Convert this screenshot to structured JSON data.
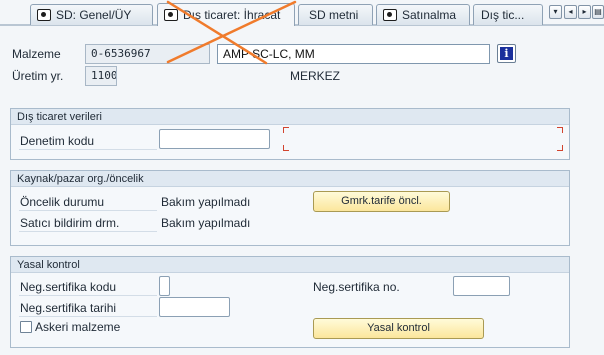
{
  "tabs": [
    {
      "label": "SD: Genel/ÜY",
      "has_icon": true,
      "active": false
    },
    {
      "label": "Dış ticaret: İhracat",
      "has_icon": true,
      "active": true
    },
    {
      "label": "SD metni",
      "has_icon": false,
      "active": false
    },
    {
      "label": "Satınalma",
      "has_icon": true,
      "active": false
    },
    {
      "label": "Dış tic...",
      "has_icon": false,
      "active": false
    }
  ],
  "tab_nav": {
    "menu": "▾",
    "prev": "◂",
    "next": "▸",
    "list": "▤"
  },
  "header": {
    "material_label": "Malzeme",
    "material_number": "0-6536967",
    "material_description": "AMP SC-LC, MM",
    "plant_label": "Üretim yr.",
    "plant_code": "1100",
    "plant_name": "MERKEZ",
    "info_icon": "i"
  },
  "foreign_trade": {
    "title": "Dış ticaret verileri",
    "inspection_code_label": "Denetim kodu",
    "inspection_code_value": ""
  },
  "origin": {
    "title": "Kaynak/pazar org./öncelik",
    "preference_status_label": "Öncelik durumu",
    "preference_status_value": "Bakım yapılmadı",
    "vendor_declaration_label": "Satıcı bildirim drm.",
    "vendor_declaration_value": "Bakım yapılmadı",
    "customs_pref_button": "Gmrk.tarife öncl."
  },
  "legal": {
    "title": "Yasal kontrol",
    "neg_cert_code_label": "Neg.sertifika kodu",
    "neg_cert_no_label": "Neg.sertifika no.",
    "neg_cert_date_label": "Neg.sertifika tarihi",
    "military_label": "Askeri malzeme",
    "military_checked": false,
    "legal_control_button": "Yasal kontrol"
  },
  "colors": {
    "accent_cross": "#f07b2c",
    "button_yellow": "#fbe69c",
    "info_blue": "#1a2f9c",
    "required_corner": "#d2442e"
  }
}
